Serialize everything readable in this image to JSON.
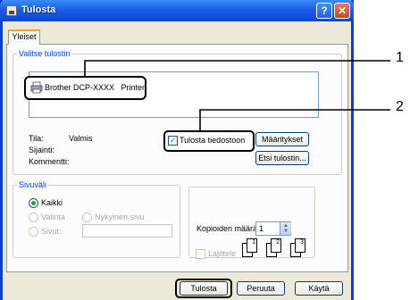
{
  "window": {
    "title": "Tulosta",
    "help_symbol": "?",
    "close_symbol": "✕"
  },
  "tabs": [
    {
      "label": "Yleiset"
    }
  ],
  "select_printer": {
    "legend": "Valitse tulostin",
    "selected_printer": "Brother DCP-XXXX   Printer",
    "status_label": "Tila:",
    "status_value": "Valmis",
    "location_label": "Sijainti:",
    "comment_label": "Kommentti:",
    "print_to_file_label": "Tulosta tiedostoon",
    "print_to_file_checked": true,
    "preferences_button": "Määritykset",
    "find_printer_button": "Etsi tulostin..."
  },
  "page_range": {
    "legend": "Sivuväli",
    "options": [
      "Kaikki",
      "Valinta",
      "Nykyinen sivu",
      "Sivut:"
    ],
    "selected": "Kaikki",
    "pages_value": ""
  },
  "copies": {
    "label": "Kopioiden määrä:",
    "value": "1",
    "collate_label": "Lajittele",
    "collate_checked": false,
    "collate_pages": [
      "1",
      "1",
      "2",
      "2",
      "3",
      "3"
    ]
  },
  "footer": {
    "print_button": "Tulosta",
    "cancel_button": "Peruuta",
    "apply_button": "Käytä"
  },
  "callouts": {
    "one": "1",
    "two": "2"
  },
  "colors": {
    "title_blue": "#0b46d2",
    "legend_blue": "#0046d5",
    "check_green": "#21a121"
  }
}
